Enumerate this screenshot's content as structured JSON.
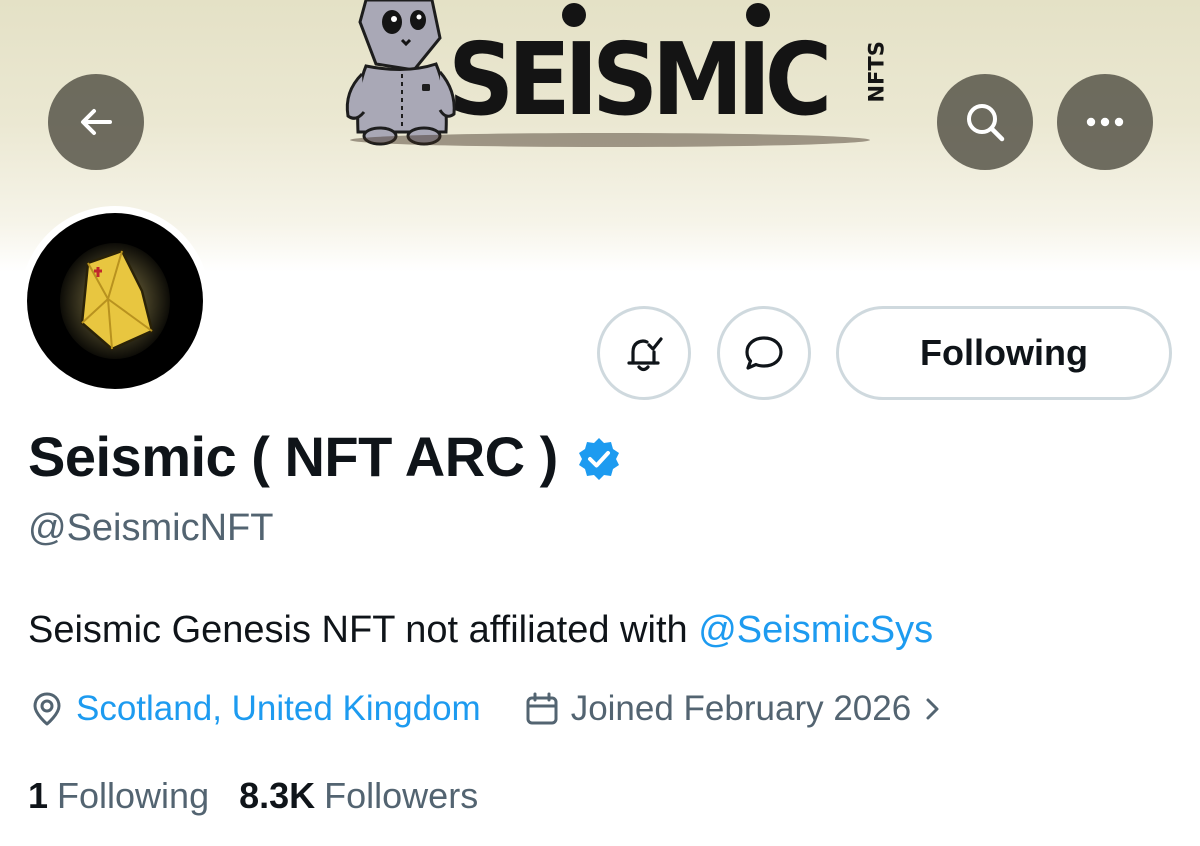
{
  "banner": {
    "logo_text": "SEISMIC",
    "logo_subtext": "NFTS"
  },
  "profile": {
    "display_name": "Seismic ( NFT ARC )",
    "handle": "@SeismicNFT",
    "bio_text": "Seismic Genesis NFT not affiliated with ",
    "bio_mention": "@SeismicSys",
    "location": "Scotland, United Kingdom",
    "joined": "Joined February 2026",
    "following_count": "1",
    "following_label": "Following",
    "followers_count": "8.3K",
    "followers_label": "Followers"
  },
  "actions": {
    "follow_label": "Following"
  },
  "icons": {
    "back": "arrow-left-icon",
    "search": "search-icon",
    "more": "more-dots-icon",
    "notifications": "bell-check-icon",
    "message": "chat-bubble-icon",
    "verified": "verified-badge-icon",
    "location": "location-pin-icon",
    "calendar": "calendar-icon",
    "chevron": "chevron-right-icon"
  },
  "colors": {
    "accent": "#1d9bf0",
    "text_primary": "#0f1419",
    "text_secondary": "#536471",
    "border": "#cfd9de",
    "avatar_gold": "#e8c640"
  }
}
